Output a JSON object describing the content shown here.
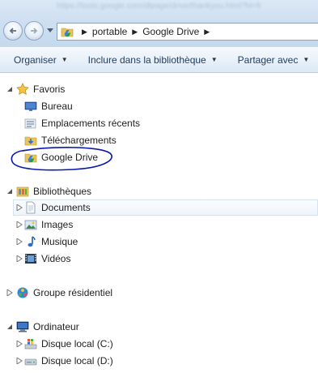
{
  "address_bar": {
    "blurred_url": "https://tools.google.com/dlpage/drive/thankyou.html?hl=fr",
    "breadcrumbs": [
      "portable",
      "Google Drive"
    ]
  },
  "toolbar": {
    "organize_label": "Organiser",
    "include_label": "Inclure dans la bibliothèque",
    "share_label": "Partager avec"
  },
  "tree": {
    "favorites": {
      "label": "Favoris",
      "items": [
        {
          "label": "Bureau",
          "icon": "desktop-icon"
        },
        {
          "label": "Emplacements récents",
          "icon": "recent-places-icon"
        },
        {
          "label": "Téléchargements",
          "icon": "downloads-icon"
        },
        {
          "label": "Google Drive",
          "icon": "google-drive-folder-icon"
        }
      ]
    },
    "libraries": {
      "label": "Bibliothèques",
      "items": [
        {
          "label": "Documents",
          "icon": "documents-icon"
        },
        {
          "label": "Images",
          "icon": "pictures-icon"
        },
        {
          "label": "Musique",
          "icon": "music-icon"
        },
        {
          "label": "Vidéos",
          "icon": "videos-icon"
        }
      ]
    },
    "homegroup": {
      "label": "Groupe résidentiel"
    },
    "computer": {
      "label": "Ordinateur",
      "items": [
        {
          "label": "Disque local (C:)",
          "icon": "windows-drive-icon"
        },
        {
          "label": "Disque local (D:)",
          "icon": "drive-icon"
        }
      ]
    }
  },
  "colors": {
    "accent": "#1e3b5c",
    "annotation_ink": "#0a18b0",
    "selection": "#eef4fb"
  }
}
